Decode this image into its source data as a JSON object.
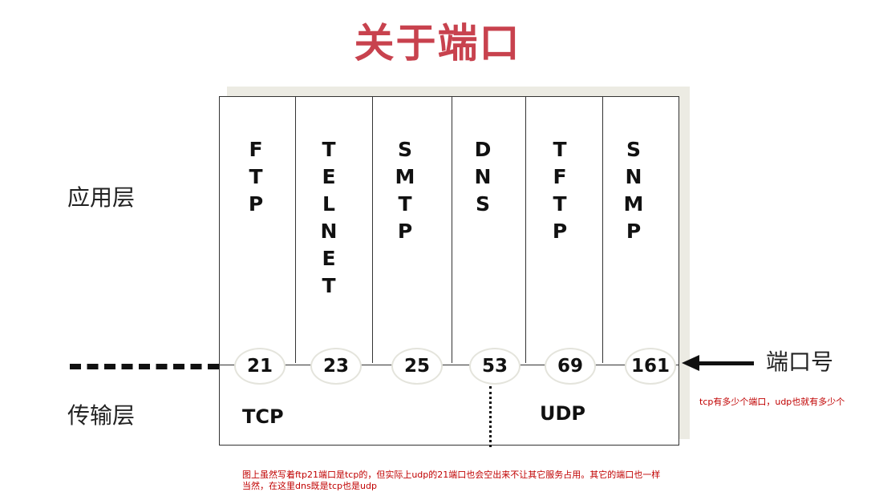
{
  "title": "关于端口",
  "layers": {
    "application": "应用层",
    "transport": "传输层"
  },
  "protocols": [
    {
      "name": "FTP",
      "letters": [
        "F",
        "T",
        "P"
      ],
      "port": "21"
    },
    {
      "name": "TELNET",
      "letters": [
        "T",
        "E",
        "L",
        "N",
        "E",
        "T"
      ],
      "port": "23"
    },
    {
      "name": "SMTP",
      "letters": [
        "S",
        "M",
        "T",
        "P"
      ],
      "port": "25"
    },
    {
      "name": "DNS",
      "letters": [
        "D",
        "N",
        "S"
      ],
      "port": "53"
    },
    {
      "name": "TFTP",
      "letters": [
        "T",
        "F",
        "T",
        "P"
      ],
      "port": "69"
    },
    {
      "name": "SNMP",
      "letters": [
        "S",
        "N",
        "M",
        "P"
      ],
      "port": "161"
    }
  ],
  "transport_protocols": {
    "tcp": "TCP",
    "udp": "UDP"
  },
  "port_label": "端口号",
  "notes": {
    "side": "tcp有多少个端口，udp也就有多少个",
    "bottom_line1": "图上虽然写着ftp21端口是tcp的，但实际上udp的21端口也会空出来不让其它服务占用。其它的端口也一样",
    "bottom_line2": "当然，在这里dns既是tcp也是udp"
  },
  "colors": {
    "title": "#c8424e",
    "note": "#c00000"
  }
}
